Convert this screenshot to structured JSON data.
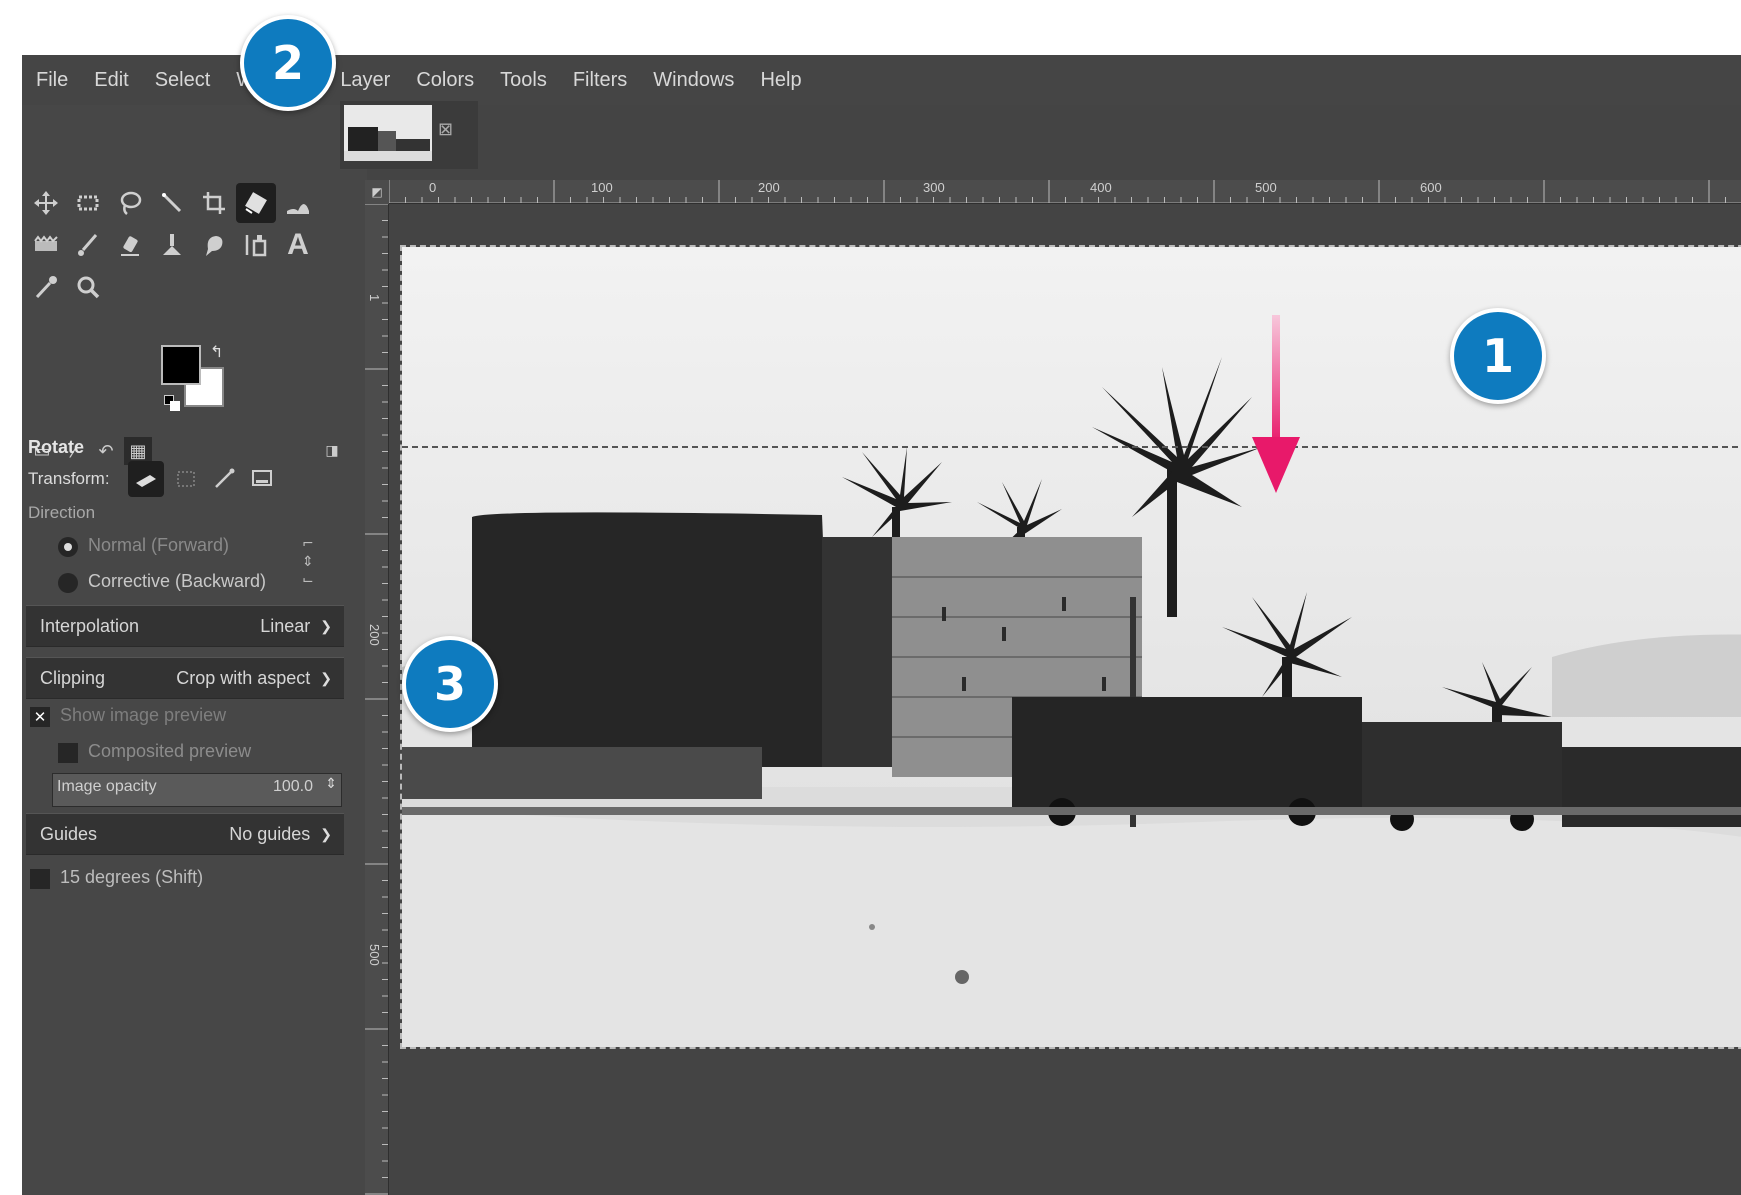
{
  "menu": [
    "File",
    "Edit",
    "Select",
    "View",
    "Image",
    "Layer",
    "Colors",
    "Tools",
    "Filters",
    "Windows",
    "Help"
  ],
  "menu_visible": [
    "File",
    "Edit",
    "Select",
    "W",
    "e",
    "Layer",
    "Colors",
    "Tools",
    "Filters",
    "Windows",
    "Help"
  ],
  "tools": [
    {
      "name": "move-tool-icon"
    },
    {
      "name": "rect-select-icon"
    },
    {
      "name": "free-select-icon"
    },
    {
      "name": "fuzzy-select-icon"
    },
    {
      "name": "crop-icon"
    },
    {
      "name": "unified-transform-icon",
      "active": true
    },
    {
      "name": "warp-icon"
    },
    {
      "name": "gradient-icon"
    },
    {
      "name": "paintbrush-icon"
    },
    {
      "name": "eraser-icon"
    },
    {
      "name": "clone-icon"
    },
    {
      "name": "smudge-icon"
    },
    {
      "name": "paint-select-icon"
    },
    {
      "name": "text-icon",
      "glyph": "A"
    },
    {
      "name": "color-picker-icon"
    },
    {
      "name": "zoom-icon"
    }
  ],
  "colors": {
    "foreground": "#000000",
    "background": "#ffffff",
    "accent": "#0e7bbf",
    "arrow": "#e8196a"
  },
  "tool_options": {
    "title": "Rotate",
    "transform_label": "Transform:",
    "direction_label": "Direction",
    "direction_normal": "Normal (Forward)",
    "direction_corrective": "Corrective (Backward)",
    "interpolation_label": "Interpolation",
    "interpolation_value": "Linear",
    "clipping_label": "Clipping",
    "clipping_value": "Crop with aspect",
    "show_preview": "Show image preview",
    "composited_preview": "Composited preview",
    "opacity_label": "Image opacity",
    "opacity_value": "100.0",
    "guides_label": "Guides",
    "guides_value": "No guides",
    "snap_label": "15 degrees (Shift)"
  },
  "ruler": {
    "h_labels": [
      "0",
      "100",
      "200",
      "300",
      "400",
      "500",
      "600"
    ],
    "v_labels": [
      "1",
      "200",
      "500"
    ]
  },
  "callouts": {
    "c1": "1",
    "c2": "2",
    "c3": "3"
  }
}
